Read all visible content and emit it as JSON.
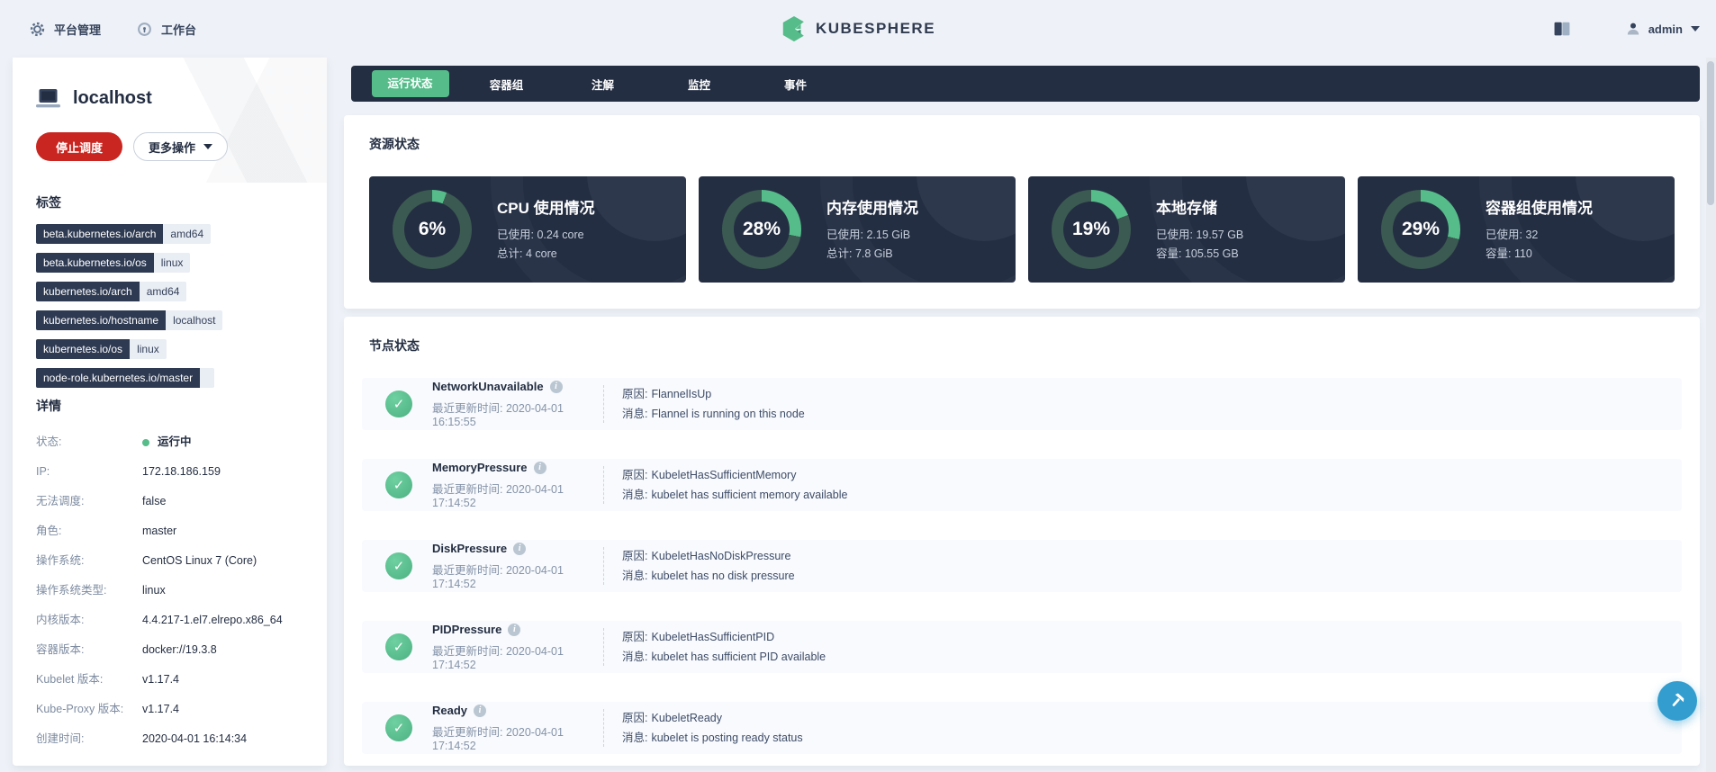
{
  "header": {
    "platform_management": "平台管理",
    "workbench": "工作台",
    "logo_text": "KUBESPHERE",
    "username": "admin"
  },
  "sidebar": {
    "title": "localhost",
    "stop_scheduling_button": "停止调度",
    "more_actions_button": "更多操作",
    "labels_heading": "标签",
    "labels": [
      {
        "key": "beta.kubernetes.io/arch",
        "value": "amd64"
      },
      {
        "key": "beta.kubernetes.io/os",
        "value": "linux"
      },
      {
        "key": "kubernetes.io/arch",
        "value": "amd64"
      },
      {
        "key": "kubernetes.io/hostname",
        "value": "localhost"
      },
      {
        "key": "kubernetes.io/os",
        "value": "linux"
      },
      {
        "key": "node-role.kubernetes.io/master",
        "value": ""
      }
    ],
    "details_heading": "详情",
    "details": [
      {
        "label": "状态:",
        "value": "运行中"
      },
      {
        "label": "IP:",
        "value": "172.18.186.159"
      },
      {
        "label": "无法调度:",
        "value": "false"
      },
      {
        "label": "角色:",
        "value": "master"
      },
      {
        "label": "操作系统:",
        "value": "CentOS Linux 7 (Core)"
      },
      {
        "label": "操作系统类型:",
        "value": "linux"
      },
      {
        "label": "内核版本:",
        "value": "4.4.217-1.el7.elrepo.x86_64"
      },
      {
        "label": "容器版本:",
        "value": "docker://19.3.8"
      },
      {
        "label": "Kubelet 版本:",
        "value": "v1.17.4"
      },
      {
        "label": "Kube-Proxy 版本:",
        "value": "v1.17.4"
      },
      {
        "label": "创建时间:",
        "value": "2020-04-01 16:14:34"
      }
    ]
  },
  "tabs": {
    "items": [
      "运行状态",
      "容器组",
      "注解",
      "监控",
      "事件"
    ],
    "active": "运行状态"
  },
  "resource_status": {
    "heading": "资源状态",
    "cards": [
      {
        "percent": 6,
        "percent_label": "6%",
        "title": "CPU 使用情况",
        "line1": "已使用: 0.24 core",
        "line2": "总计: 4 core"
      },
      {
        "percent": 28,
        "percent_label": "28%",
        "title": "内存使用情况",
        "line1": "已使用: 2.15 GiB",
        "line2": "总计: 7.8 GiB"
      },
      {
        "percent": 19,
        "percent_label": "19%",
        "title": "本地存储",
        "line1": "已使用: 19.57 GB",
        "line2": "容量: 105.55 GB"
      },
      {
        "percent": 29,
        "percent_label": "29%",
        "title": "容器组使用情况",
        "line1": "已使用: 32",
        "line2": "容量: 110"
      }
    ]
  },
  "node_status": {
    "heading": "节点状态",
    "time_label": "最近更新时间:",
    "reason_label": "原因:",
    "message_label": "消息:",
    "conditions": [
      {
        "name": "NetworkUnavailable",
        "time": "2020-04-01 16:15:55",
        "reason": "FlannelIsUp",
        "message": "Flannel is running on this node"
      },
      {
        "name": "MemoryPressure",
        "time": "2020-04-01 17:14:52",
        "reason": "KubeletHasSufficientMemory",
        "message": "kubelet has sufficient memory available"
      },
      {
        "name": "DiskPressure",
        "time": "2020-04-01 17:14:52",
        "reason": "KubeletHasNoDiskPressure",
        "message": "kubelet has no disk pressure"
      },
      {
        "name": "PIDPressure",
        "time": "2020-04-01 17:14:52",
        "reason": "KubeletHasSufficientPID",
        "message": "kubelet has sufficient PID available"
      },
      {
        "name": "Ready",
        "time": "2020-04-01 17:14:52",
        "reason": "KubeletReady",
        "message": "kubelet is posting ready status"
      }
    ]
  },
  "colors": {
    "accent_green": "#55bc8a",
    "donut_track": "#3b5a51",
    "dark_navy": "#242e42",
    "danger_red": "#ca2621",
    "fab_blue": "#329dce"
  }
}
